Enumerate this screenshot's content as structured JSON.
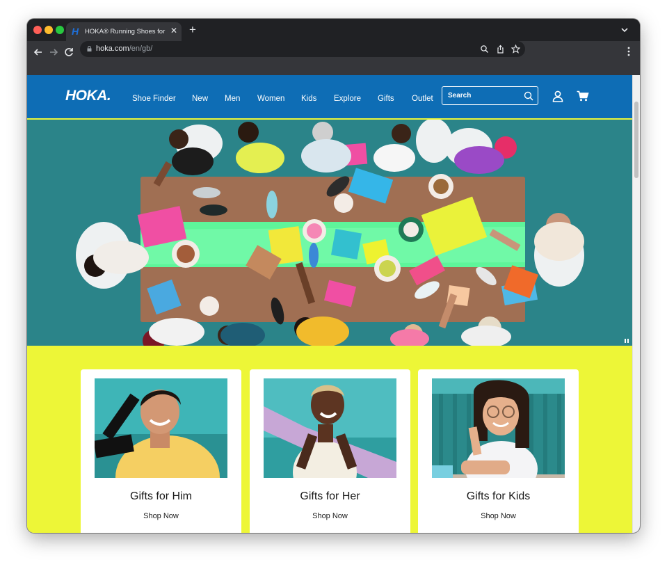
{
  "browser": {
    "tab": {
      "title": "HOKA® Running Shoes for Me",
      "favicon": "H"
    },
    "new_tab_glyph": "+",
    "url": {
      "host": "hoka.com",
      "path": "/en/gb/"
    }
  },
  "header": {
    "logo": "HOKA.",
    "nav": [
      "Shoe Finder",
      "New",
      "Men",
      "Women",
      "Kids",
      "Explore",
      "Gifts",
      "Outlet"
    ],
    "search_placeholder": "Search"
  },
  "promo": {
    "cards": [
      {
        "title": "Gifts for Him",
        "link": "Shop Now"
      },
      {
        "title": "Gifts for Her",
        "link": "Shop Now"
      },
      {
        "title": "Gifts for Kids",
        "link": "Shop Now"
      }
    ]
  },
  "colors": {
    "brand_blue": "#0e6db5",
    "promo_yellow": "#edf637",
    "hero_teal": "#2e8a8f"
  },
  "icons": [
    "back-arrow-icon",
    "forward-arrow-icon",
    "reload-icon",
    "lock-icon",
    "zoom-icon",
    "share-icon",
    "bookmark-star-icon",
    "more-menu-icon",
    "search-icon",
    "account-icon",
    "cart-icon",
    "pause-icon"
  ]
}
